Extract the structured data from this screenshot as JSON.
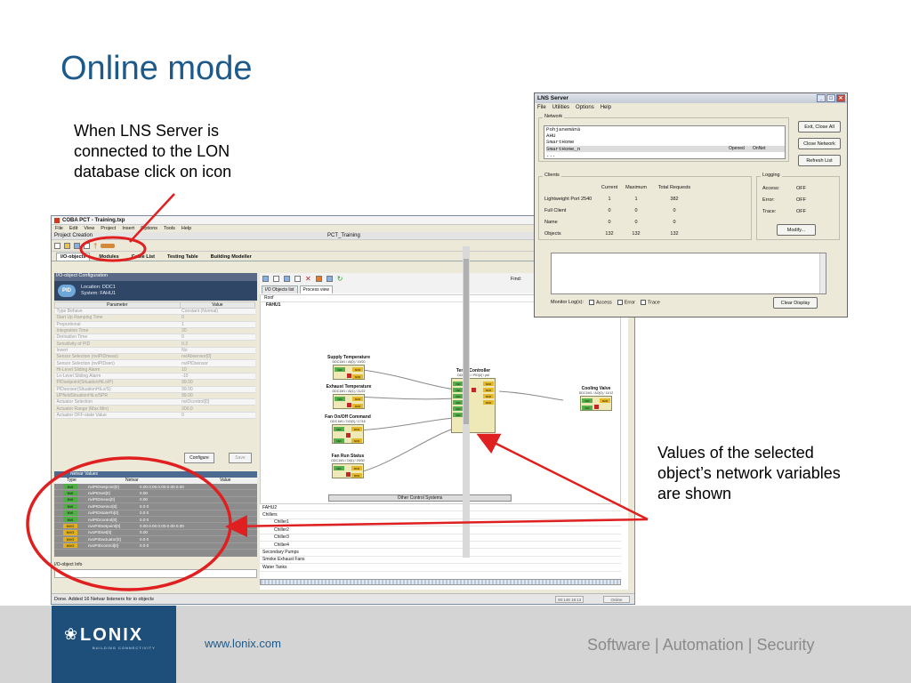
{
  "slide": {
    "title": "Online mode",
    "callout_left": "When LNS Server is connected to the LON database click on icon",
    "callout_right": "Values of the selected object’s network variables are shown"
  },
  "app": {
    "title": "COBA PCT - Training.txp",
    "menu": [
      "File",
      "Edit",
      "View",
      "Project",
      "Insert",
      "Options",
      "Tools",
      "Help"
    ],
    "project_creation": "Project Creation",
    "project_name": "PCT_Training",
    "tabs": [
      "I/O-objects",
      "Modules",
      "Cable List",
      "Testing Table",
      "Building Modeller"
    ],
    "io_config": {
      "header": "I/O-object Configuration",
      "badge": "PID",
      "location": "Location: DDC1",
      "system": "System: FAHU1",
      "col_param": "Parameter",
      "col_value": "Value",
      "params": [
        [
          "Type Behave",
          "Constant (Normal)"
        ],
        [
          "Start Up Ramping Time",
          "0"
        ],
        [
          "Proportional",
          "1"
        ],
        [
          "Integration Time",
          "20"
        ],
        [
          "Derivation Time",
          "0"
        ],
        [
          "Sensitivity of PID",
          "0.2"
        ],
        [
          "Invert",
          "No"
        ],
        [
          "Sensor Selection (nviPIDmeas)",
          "nviAbsensor[0]"
        ],
        [
          "Sensor Selection (nviPIDsen)",
          "nviPIDsensor"
        ],
        [
          "Hi-Level Sliding Alarm",
          "10"
        ],
        [
          "Lo-Level Sliding Alarm",
          "-10"
        ],
        [
          "PIDsetpoint(SituationHiLo/P)",
          "99.00"
        ],
        [
          "PIDsensor(SituationHiLo/S)",
          "99.00"
        ],
        [
          "UPfieldSituationHiLo/SPR",
          "99.00"
        ],
        [
          "Actuator Selection",
          "nviOcontrol[0]"
        ],
        [
          "Actuator Range (Max Min)",
          "200.0"
        ],
        [
          "Actuator OFF-state Value",
          "0"
        ]
      ],
      "configure_btn": "Configure",
      "save_btn": "Save"
    },
    "nv_panel": {
      "header": "Netvar Values",
      "col_type": "Type",
      "col_netvar": "Netvar",
      "col_value": "Value",
      "rows": [
        {
          "type": "NVI",
          "name": "nviPIDsetpoint[0]",
          "value": "0.00.0.00.0.00.0.00.0.00"
        },
        {
          "type": "NVI",
          "name": "nviPIDset[0]",
          "value": "0.00"
        },
        {
          "type": "NVI",
          "name": "nviPIDmeas[0]",
          "value": "0.00"
        },
        {
          "type": "NVI",
          "name": "nviPIDsensor[0]",
          "value": "0.0 0"
        },
        {
          "type": "NVI",
          "name": "nviPIDstateFb[0]",
          "value": "0.0 0"
        },
        {
          "type": "NVI",
          "name": "nviPIDcontrol[0]",
          "value": "0.0 0"
        },
        {
          "type": "NVO",
          "name": "nvoPIDsetpoint[0]",
          "value": "0.00.0.00.0.00.0.00.0.00"
        },
        {
          "type": "NVO",
          "name": "nvoPIDset[0]",
          "value": "0.00"
        },
        {
          "type": "NVO",
          "name": "nvoPIDactuator[0]",
          "value": "0.0 0"
        },
        {
          "type": "NVO",
          "name": "nvoPIDcontrol[0]",
          "value": "0.0 0"
        }
      ]
    },
    "io_info": "I/O-object Info",
    "view": {
      "find_label": "Find:",
      "tab1": "I/O Objects list",
      "tab2": "Process view",
      "breadcrumb": "Roof",
      "fahu_label": "FAHU1",
      "other_systems": "Other Control Systems",
      "blocks": {
        "supply": {
          "title": "Supply Temperature",
          "sub": "DDC1M1 / AI[0] / 19/20"
        },
        "exhaust": {
          "title": "Exhaust Temperature",
          "sub": "DDC1M1 / AI[1] / 21/22"
        },
        "fan_onoff": {
          "title": "Fan On/Off Command",
          "sub": "DDC1M1 / DO[0] / 17/18"
        },
        "fan_run": {
          "title": "Fan Run Status",
          "sub": "DDC1M1 / DI[1] / 29/30"
        },
        "temp_ctrl": {
          "title": "Temp Controller",
          "sub": "DDC1M1 / PID[0] / pid"
        },
        "cooling": {
          "title": "Cooling Valve",
          "sub": "DDC1M1 / AO[0] / 11/12"
        }
      },
      "tree": [
        "FAHU2",
        "Chillers",
        "Chiller1",
        "Chiller2",
        "Chiller3",
        "Chiller4",
        "Secondary Pumps",
        "Smoke Exhaust Fans",
        "Water Tanks"
      ]
    },
    "status": "Done. Added 16 Netvar listeners for io objects",
    "status_time": "00:148 18:13",
    "status_mode": "Online"
  },
  "lns": {
    "title": "LNS Server",
    "menu": [
      "File",
      "Utilities",
      "Options",
      "Help"
    ],
    "network_label": "Network",
    "networks": [
      {
        "name": "Pohjanemänä",
        "state": "",
        "mode": ""
      },
      {
        "name": "AHU",
        "state": "",
        "mode": ""
      },
      {
        "name": "SmartHome",
        "state": "",
        "mode": ""
      },
      {
        "name": "SmartHome_n",
        "state": "Opened",
        "mode": "OnNet"
      },
      {
        "name": "...",
        "state": "",
        "mode": ""
      }
    ],
    "btn_exit": "Exit, Close All",
    "btn_close_network": "Close Network",
    "btn_refresh": "Refresh List",
    "clients_label": "Clients",
    "clients_cols": [
      "",
      "Current",
      "Maximum",
      "Total Requests"
    ],
    "clients": [
      [
        "Lightweight Port 2540",
        "1",
        "1",
        "382"
      ],
      [
        "Full Client",
        "0",
        "0",
        "0"
      ],
      [
        "Name",
        "0",
        "0",
        "0"
      ],
      [
        "Objects",
        "132",
        "132",
        "132"
      ]
    ],
    "logging_label": "Logging",
    "logging": [
      [
        "Access:",
        "OFF"
      ],
      [
        "Error:",
        "OFF"
      ],
      [
        "Trace:",
        "OFF"
      ]
    ],
    "btn_modify": "Modify...",
    "monitor_label": "Monitor Log(s):",
    "chk_access": "Access",
    "chk_error": "Error",
    "chk_trace": "Trace",
    "btn_clear": "Clear Display"
  },
  "footer": {
    "logo": "LONIX",
    "logo_sub": "BUILDING CONNECTIVITY",
    "url": "www.lonix.com",
    "tagline": "Software | Automation | Security"
  },
  "colors": {
    "title": "#1d5a8a",
    "annotation": "#e02020",
    "footer_bg": "#d4d4d4",
    "logo_bg": "#1d4f7a"
  }
}
